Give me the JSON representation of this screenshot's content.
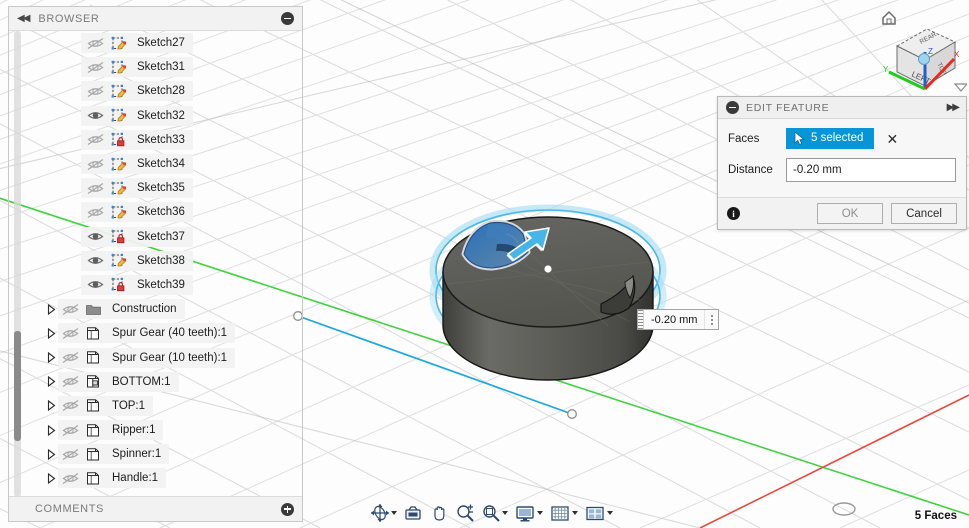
{
  "browser": {
    "title": "BROWSER",
    "collapse_icon": "double-left-arrow-icon",
    "minimize_icon": "minus-circle-icon",
    "comments_title": "COMMENTS",
    "add_comment_icon": "plus-circle-icon",
    "items": [
      {
        "label": "Sketch27",
        "type": "sketch",
        "visible": false,
        "locked": false,
        "expandable": false
      },
      {
        "label": "Sketch31",
        "type": "sketch",
        "visible": false,
        "locked": false,
        "expandable": false
      },
      {
        "label": "Sketch28",
        "type": "sketch",
        "visible": false,
        "locked": false,
        "expandable": false
      },
      {
        "label": "Sketch32",
        "type": "sketch",
        "visible": true,
        "locked": false,
        "expandable": false
      },
      {
        "label": "Sketch33",
        "type": "sketch",
        "visible": false,
        "locked": true,
        "expandable": false
      },
      {
        "label": "Sketch34",
        "type": "sketch",
        "visible": false,
        "locked": false,
        "expandable": false
      },
      {
        "label": "Sketch35",
        "type": "sketch",
        "visible": false,
        "locked": false,
        "expandable": false
      },
      {
        "label": "Sketch36",
        "type": "sketch",
        "visible": false,
        "locked": false,
        "expandable": false
      },
      {
        "label": "Sketch37",
        "type": "sketch",
        "visible": true,
        "locked": true,
        "expandable": false
      },
      {
        "label": "Sketch38",
        "type": "sketch",
        "visible": true,
        "locked": false,
        "expandable": false
      },
      {
        "label": "Sketch39",
        "type": "sketch",
        "visible": true,
        "locked": true,
        "expandable": false
      },
      {
        "label": "Construction",
        "type": "folder",
        "visible": false,
        "locked": false,
        "expandable": true
      },
      {
        "label": "Spur Gear (40 teeth):1",
        "type": "component",
        "visible": false,
        "locked": false,
        "expandable": true
      },
      {
        "label": "Spur Gear (10 teeth):1",
        "type": "component",
        "visible": false,
        "locked": false,
        "expandable": true
      },
      {
        "label": "BOTTOM:1",
        "type": "component-split",
        "visible": false,
        "locked": false,
        "expandable": true
      },
      {
        "label": "TOP:1",
        "type": "component",
        "visible": false,
        "locked": false,
        "expandable": true
      },
      {
        "label": "Ripper:1",
        "type": "component",
        "visible": false,
        "locked": false,
        "expandable": true
      },
      {
        "label": "Spinner:1",
        "type": "component",
        "visible": false,
        "locked": false,
        "expandable": true
      },
      {
        "label": "Handle:1",
        "type": "component",
        "visible": false,
        "locked": false,
        "expandable": true
      }
    ]
  },
  "edit_feature": {
    "title": "EDIT FEATURE",
    "minimize_icon": "minus-circle-icon",
    "expand_icon": "double-right-arrow-icon",
    "faces_label": "Faces",
    "faces_value": "5 selected",
    "faces_cursor_icon": "cursor-arrow-icon",
    "clear_icon": "close-x-icon",
    "distance_label": "Distance",
    "distance_value": "-0.20 mm",
    "info_icon": "info-icon",
    "ok_label": "OK",
    "cancel_label": "Cancel",
    "accent_color": "#0696d7"
  },
  "canvas": {
    "dimension_callout": "-0.20 mm",
    "callout_menu_icon": "more-vertical-icon",
    "grip_icon": "drag-grip-icon",
    "model_body_color": "#5a5a57",
    "selection_color": "#2e6db5",
    "manipulator_color": "#44b4e6",
    "axis_x_color": "#e8493f",
    "axis_y_color": "#3fd23f",
    "selection_line_color": "#1ba7e0"
  },
  "viewcube": {
    "face_label": "LEFT",
    "top_label": "REAR",
    "right_label": "TOP",
    "home_icon": "home-icon",
    "dropdown_icon": "view-dropdown-icon",
    "axis_x_label": "X",
    "axis_y_label": "Y",
    "axis_z_label": "Z"
  },
  "toolbar": {
    "items": [
      {
        "name": "orbit-icon",
        "caret": true
      },
      {
        "name": "look-at-icon",
        "caret": false
      },
      {
        "name": "pan-hand-icon",
        "caret": false
      },
      {
        "name": "zoom-in-out-icon",
        "caret": false
      },
      {
        "name": "zoom-window-icon",
        "caret": true
      },
      {
        "name": "display-settings-icon",
        "caret": true
      },
      {
        "name": "grid-snaps-icon",
        "caret": true
      },
      {
        "name": "viewports-icon",
        "caret": true
      }
    ]
  },
  "status": {
    "selection_count": "5 Faces"
  }
}
